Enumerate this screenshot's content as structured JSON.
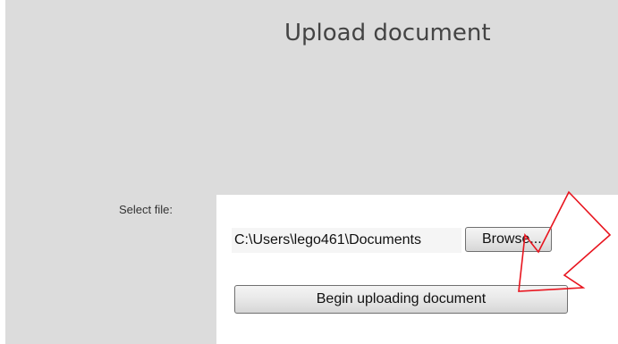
{
  "page": {
    "title": "Upload document"
  },
  "form": {
    "select_label": "Select file:",
    "file_path_value": "C:\\Users\\lego461\\Documents",
    "browse_label": "Browse...",
    "upload_label": "Begin uploading document"
  },
  "annotation": {
    "icon": "arrow-down-left-icon",
    "color": "#e8141e"
  },
  "colors": {
    "panel_background": "#dcdcdc",
    "form_background": "#ffffff"
  }
}
